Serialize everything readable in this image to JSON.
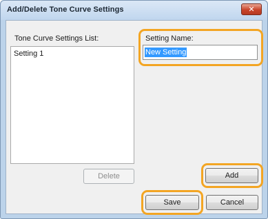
{
  "window": {
    "title": "Add/Delete Tone Curve Settings",
    "close_glyph": "✕"
  },
  "list": {
    "label": "Tone Curve Settings List:",
    "items": [
      "Setting 1"
    ]
  },
  "setting_name": {
    "label": "Setting Name:",
    "value": "New Setting"
  },
  "buttons": {
    "delete": "Delete",
    "add": "Add",
    "save": "Save",
    "cancel": "Cancel"
  },
  "highlight_color": "#f3a523"
}
